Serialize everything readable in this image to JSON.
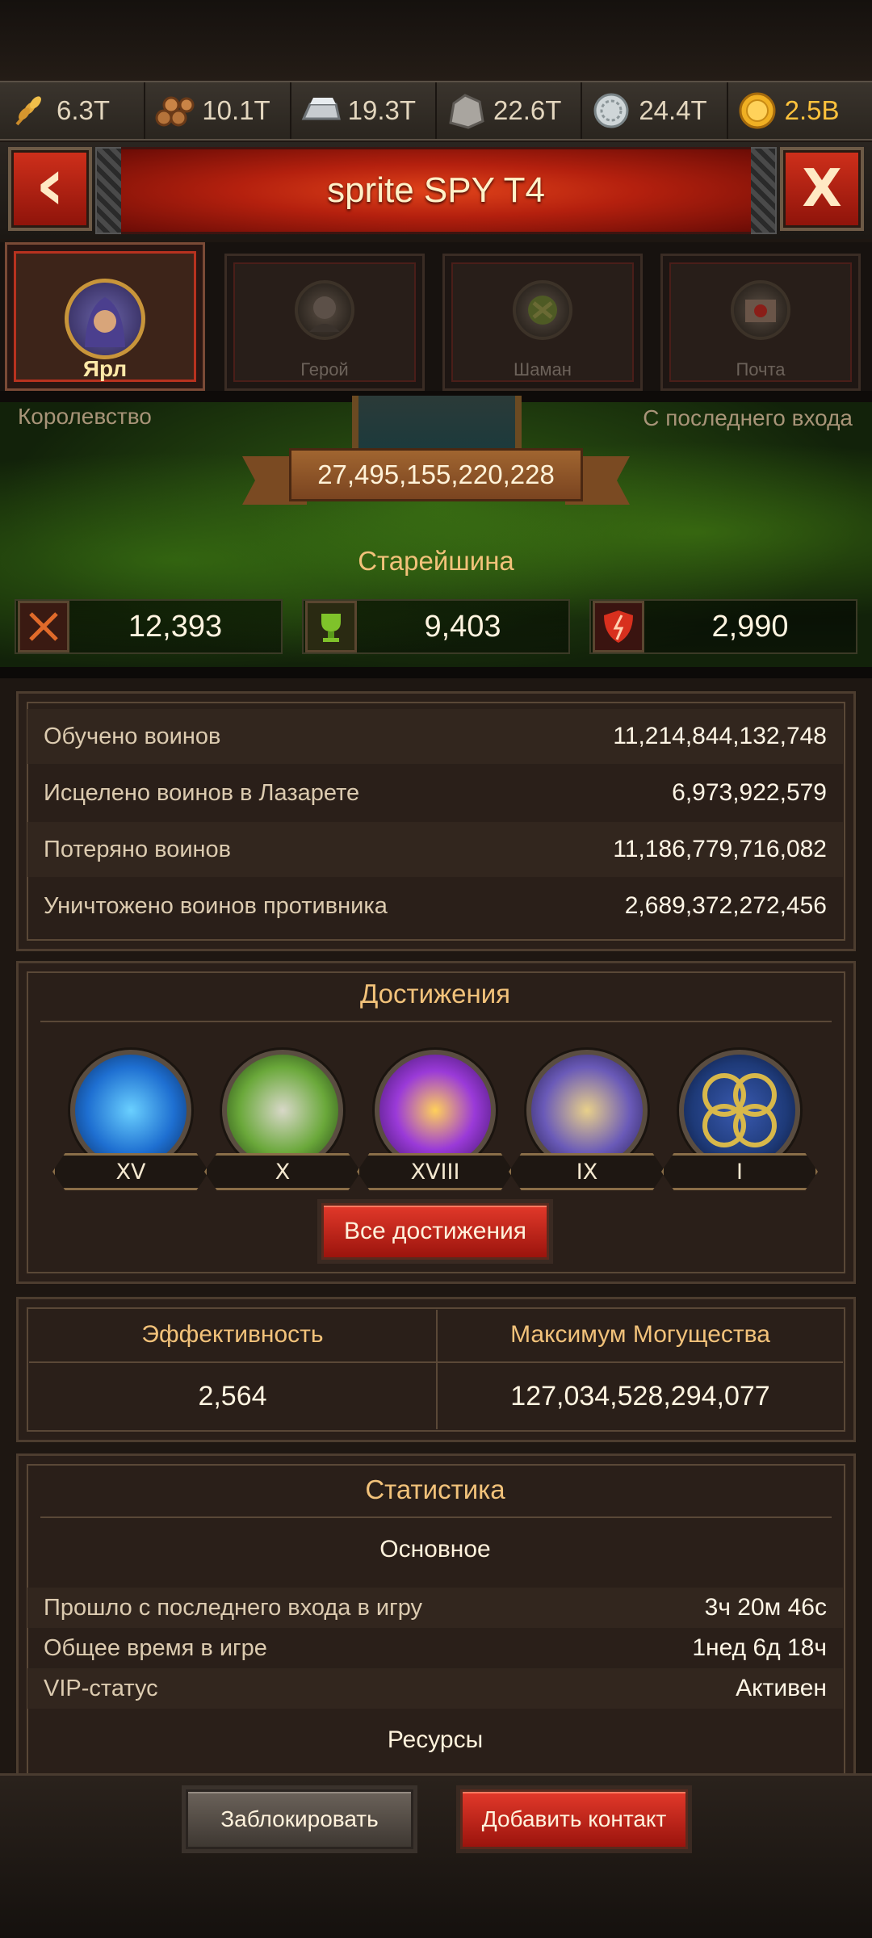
{
  "resources": [
    {
      "icon": "wheat-icon",
      "value": "6.3T"
    },
    {
      "icon": "wood-logs-icon",
      "value": "10.1T"
    },
    {
      "icon": "iron-ingot-icon",
      "value": "19.3T"
    },
    {
      "icon": "stone-icon",
      "value": "22.6T"
    },
    {
      "icon": "silver-icon",
      "value": "24.4T"
    },
    {
      "icon": "gold-coin-icon",
      "value": "2.5B"
    }
  ],
  "header": {
    "title": "sprite SPY T4",
    "back": "‹",
    "close": "X"
  },
  "tabs": [
    {
      "label": "Ярл",
      "active": true
    },
    {
      "label": "Герой"
    },
    {
      "label": "Шаман"
    },
    {
      "label": "Почта"
    }
  ],
  "profile": {
    "kingdom_label": "Королевство",
    "last_login_label": "С последнего входа",
    "power": "27,495,155,220,228",
    "rank": "Старейшина",
    "stats": [
      {
        "icon": "crossed-swords-icon",
        "value": "12,393"
      },
      {
        "icon": "trophy-icon",
        "value": "9,403"
      },
      {
        "icon": "shield-icon",
        "value": "2,990"
      }
    ]
  },
  "warriors": [
    {
      "label": "Обучено воинов",
      "value": "11,214,844,132,748"
    },
    {
      "label": "Исцелено воинов в Лазарете",
      "value": "6,973,922,579"
    },
    {
      "label": "Потеряно воинов",
      "value": "11,186,779,716,082"
    },
    {
      "label": "Уничтожено воинов противника",
      "value": "2,689,372,272,456"
    }
  ],
  "achievements": {
    "title": "Достижения",
    "items": [
      {
        "icon": "globe-achievement-icon",
        "level": "XV",
        "color": "#1e6fd1"
      },
      {
        "icon": "mask-achievement-icon",
        "level": "X",
        "color": "#3e8a2a"
      },
      {
        "icon": "treasure-chest-achievement-icon",
        "level": "XVIII",
        "color": "#7a2fb4"
      },
      {
        "icon": "statue-achievement-icon",
        "level": "IX",
        "color": "#5b4aa8"
      },
      {
        "icon": "rings-achievement-icon",
        "level": "I",
        "color": "#1e3a78"
      }
    ],
    "all_button": "Все достижения"
  },
  "efficiency": {
    "left_label": "Эффективность",
    "left_value": "2,564",
    "right_label": "Максимум Могущества",
    "right_value": "127,034,528,294,077"
  },
  "statistics": {
    "title": "Статистика",
    "main_section": "Основное",
    "rows": [
      {
        "label": "Прошло с последнего входа в игру",
        "value": "3ч 20м 46с"
      },
      {
        "label": "Общее время в игре",
        "value": "1нед 6д 18ч"
      },
      {
        "label": "VIP-статус",
        "value": "Активен"
      }
    ],
    "resources_section": "Ресурсы"
  },
  "footer": {
    "block_button": "Заблокировать",
    "add_contact_button": "Добавить контакт"
  }
}
